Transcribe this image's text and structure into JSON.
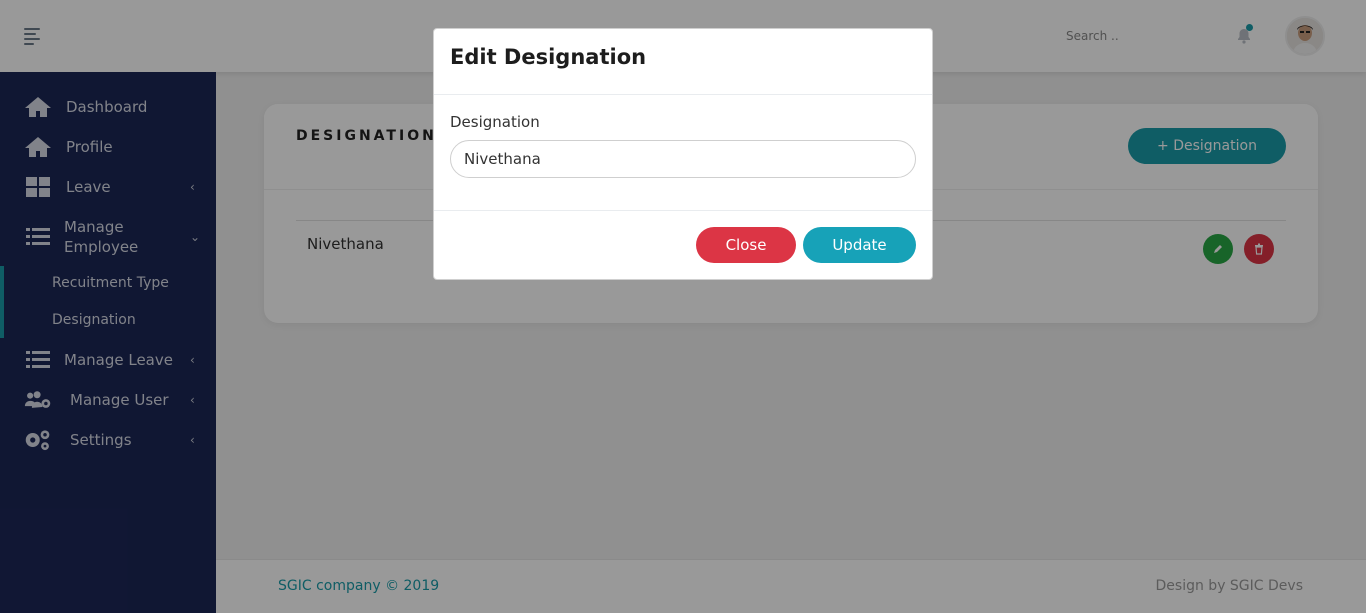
{
  "header": {
    "search_placeholder": "Search ..",
    "notification_dot_color": "#1a9ba8"
  },
  "sidebar": {
    "items": [
      {
        "label": "Dashboard",
        "icon": "home-icon"
      },
      {
        "label": "Profile",
        "icon": "home-icon"
      },
      {
        "label": "Leave",
        "icon": "grid-icon",
        "chevron": "‹"
      },
      {
        "label_line1": "Manage",
        "label_line2": "Employee",
        "icon": "list-icon",
        "chevron": "⌄"
      },
      {
        "label": "Manage Leave",
        "icon": "list-icon",
        "chevron": "‹"
      },
      {
        "label": "Manage User",
        "icon": "users-gear-icon",
        "chevron": "‹"
      },
      {
        "label": "Settings",
        "icon": "gears-icon",
        "chevron": "‹"
      }
    ],
    "subitems": [
      {
        "label": "Recuitment Type"
      },
      {
        "label": "Designation"
      }
    ]
  },
  "main": {
    "card_title": "DESIGNATION",
    "add_button_label": "+ Designation",
    "rows": [
      {
        "name": "Nivethana"
      }
    ]
  },
  "footer": {
    "left": "SGIC company © 2019",
    "right": "Design by SGIC Devs"
  },
  "modal": {
    "title": "Edit Designation",
    "field_label": "Designation",
    "field_value": "Nivethana",
    "close_label": "Close",
    "update_label": "Update"
  },
  "colors": {
    "sidebar_bg": "#1c2756",
    "accent": "#1a9ba8",
    "danger": "#dc3545",
    "success": "#28a745"
  }
}
